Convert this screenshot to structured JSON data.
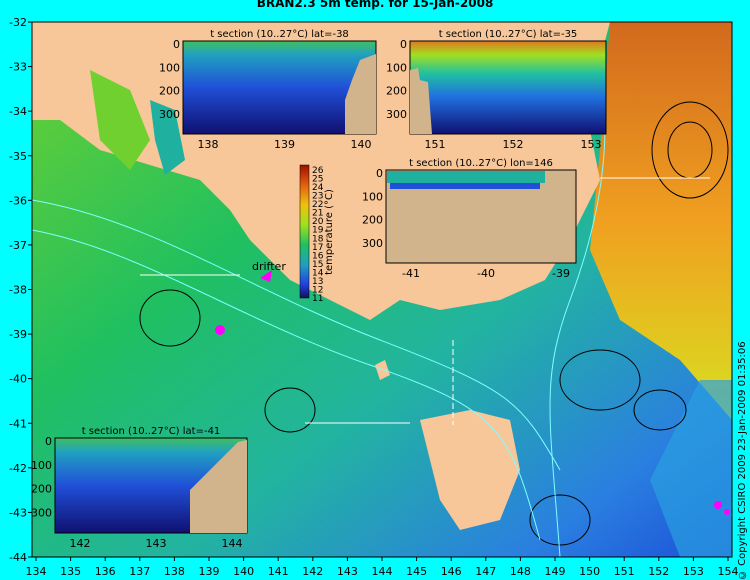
{
  "map": {
    "title_line1": "BRAN2.3 5m temp. for 15-Jan-2008",
    "lat_ticks": [
      "-32",
      "-33",
      "-34",
      "-35",
      "-36",
      "-37",
      "-38",
      "-39",
      "-40",
      "-41",
      "-42",
      "-43",
      "-44"
    ],
    "lon_ticks": [
      "134",
      "135",
      "136",
      "137",
      "138",
      "139",
      "140",
      "141",
      "142",
      "143",
      "144",
      "145",
      "146",
      "147",
      "148",
      "149",
      "150",
      "151",
      "152",
      "153",
      "154"
    ],
    "drifter_label": "drifter",
    "credit": "© Copyright CSIRO 2009   23-Jan-2009 01:35:06",
    "colors": {
      "background": "#00ffff",
      "land": "#f7c79a",
      "sea_deep": "#1c4fd8",
      "sea_mid": "#20c060",
      "sea_warm": "#e07820",
      "section_bathymetry": "#d2b48c",
      "drifter": "#ff00ff"
    }
  },
  "colorbar": {
    "label": "temperature (°C)",
    "ticks": [
      "26",
      "25",
      "24",
      "23",
      "22",
      "21",
      "20",
      "19",
      "18",
      "17",
      "16",
      "15",
      "14",
      "13",
      "12",
      "11"
    ]
  },
  "insets": [
    {
      "id": "lat38",
      "title": "t section (10..27°C) lat=-38",
      "x_ticks": [
        "138",
        "139",
        "140"
      ],
      "y_ticks": [
        "0",
        "100",
        "200",
        "300"
      ]
    },
    {
      "id": "lat35",
      "title": "t section (10..27°C) lat=-35",
      "x_ticks": [
        "151",
        "152",
        "153"
      ],
      "y_ticks": [
        "0",
        "100",
        "200",
        "300"
      ]
    },
    {
      "id": "lon146",
      "title": "t section (10..27°C) lon=146",
      "x_ticks": [
        "-41",
        "-40",
        "-39"
      ],
      "y_ticks": [
        "0",
        "100",
        "200",
        "300"
      ]
    },
    {
      "id": "lat41",
      "title": "t section (10..27°C) lat=-41",
      "x_ticks": [
        "142",
        "143",
        "144"
      ],
      "y_ticks": [
        "0",
        "100",
        "200",
        "300"
      ]
    }
  ]
}
